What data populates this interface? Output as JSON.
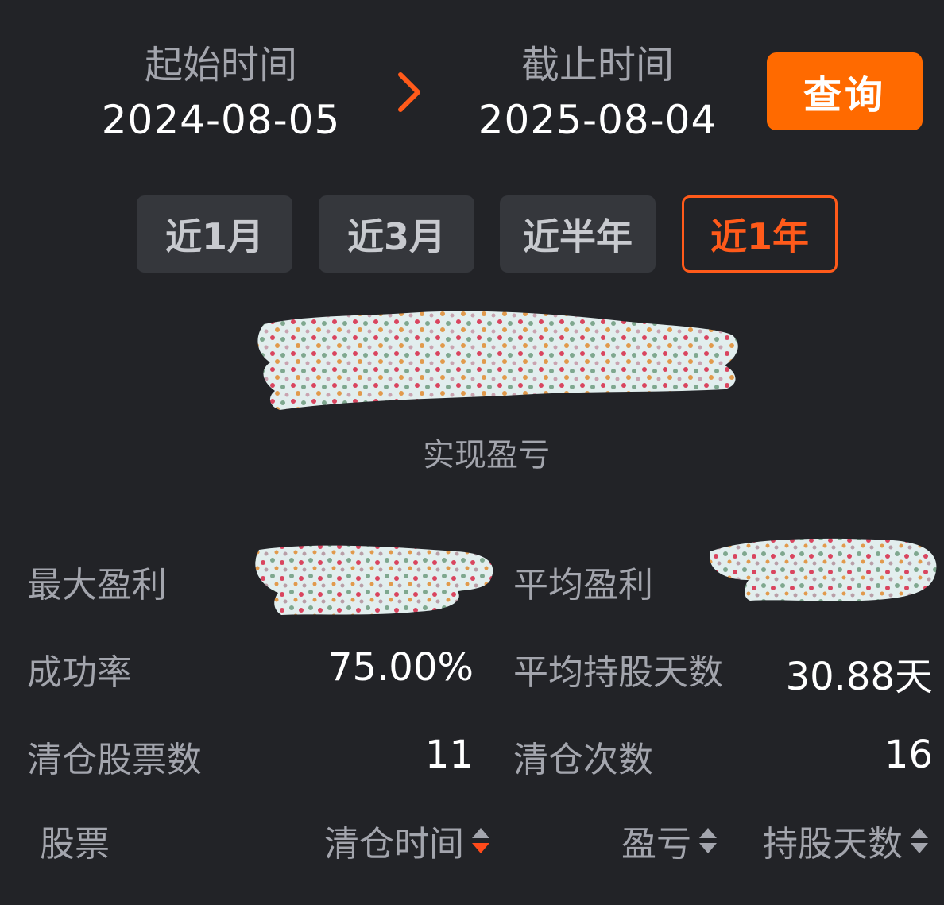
{
  "header": {
    "start_label": "起始时间",
    "start_date": "2024-08-05",
    "end_label": "截止时间",
    "end_date": "2025-08-04",
    "query_label": "查询"
  },
  "periods": [
    {
      "label": "近1月",
      "active": false
    },
    {
      "label": "近3月",
      "active": false
    },
    {
      "label": "近半年",
      "active": false
    },
    {
      "label": "近1年",
      "active": true
    }
  ],
  "summary": {
    "realized_pnl_label": "实现盈亏"
  },
  "stats": {
    "max_profit_label": "最大盈利",
    "avg_profit_label": "平均盈利",
    "success_rate_label": "成功率",
    "success_rate_value": "75.00%",
    "avg_hold_days_label": "平均持股天数",
    "avg_hold_days_value": "30.88天",
    "cleared_stocks_label": "清仓股票数",
    "cleared_stocks_value": "11",
    "cleared_times_label": "清仓次数",
    "cleared_times_value": "16"
  },
  "table": {
    "columns": [
      "股票",
      "清仓时间",
      "盈亏",
      "持股天数"
    ]
  },
  "colors": {
    "background": "#222327",
    "accent": "#ff6a00",
    "active_chip": "#ff5a1a",
    "label": "#a3a5ad",
    "chip_bg": "#35373c"
  }
}
